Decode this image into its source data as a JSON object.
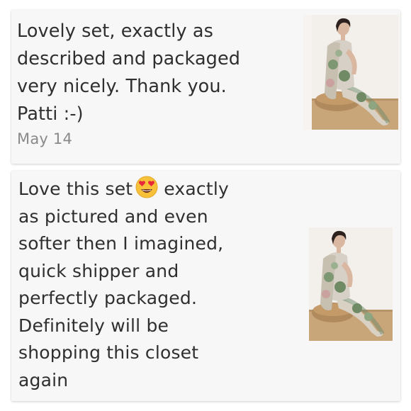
{
  "reviews": [
    {
      "text": "Lovely set, exactly as\ndescribed and packaged\nvery nicely. Thank you.\nPatti :-)",
      "date": "May 14",
      "photo_icon": "model-lounge-set-photo"
    },
    {
      "text_before_emoji": "Love this set",
      "emoji": "heart-eyes-emoji",
      "text_after_emoji": "exactly\nas pictured and even\nsofter then I imagined,\nquick shipper and\nperfectly packaged.\nDefinitely will be\nshopping this closet\nagain",
      "photo_icon": "model-lounge-set-photo"
    }
  ],
  "colors": {
    "card_bg": "#f8f7f8",
    "text": "#2f2f2f",
    "date": "#8a8a8a"
  }
}
